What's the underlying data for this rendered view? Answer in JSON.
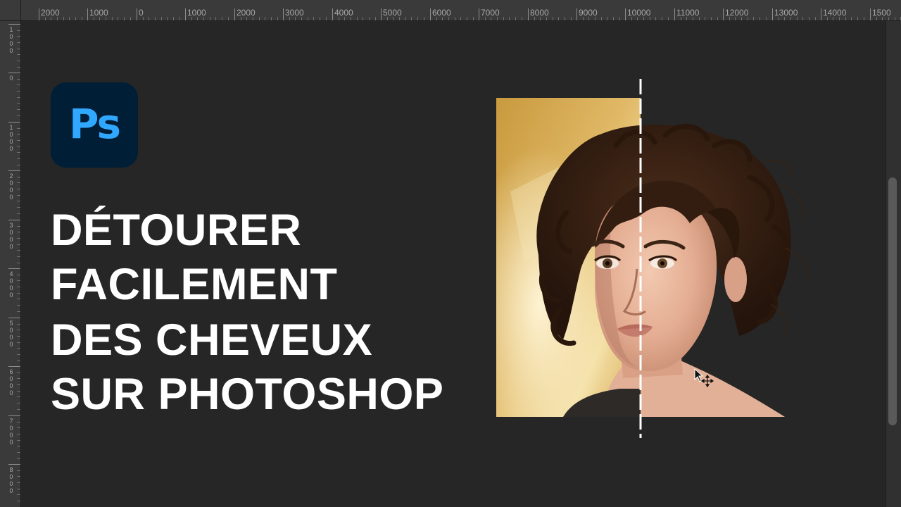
{
  "ruler_h": {
    "labels": [
      "2000",
      "1000",
      "0",
      "1000",
      "2000",
      "3000",
      "4000",
      "5000",
      "6000",
      "7000",
      "8000",
      "9000",
      "10000",
      "11000",
      "12000",
      "13000",
      "14000",
      "1500"
    ]
  },
  "ruler_v": {
    "labels": [
      "1000",
      "0",
      "1000",
      "2000",
      "3000",
      "4000",
      "5000",
      "6000",
      "7000",
      "8000"
    ]
  },
  "logo": {
    "text": "Ps",
    "name": "photoshop-logo"
  },
  "title": {
    "lines": [
      "DÉTOURER",
      "FACILEMENT",
      "DES CHEVEUX",
      "SUR PHOTOSHOP"
    ]
  },
  "colors": {
    "canvas_bg": "#262626",
    "ruler_bg": "#3a3a3a",
    "logo_bg": "#001e36",
    "logo_fg": "#31a8ff",
    "title_fg": "#ffffff"
  },
  "icons": [
    "photoshop-logo",
    "move-cursor-icon"
  ]
}
